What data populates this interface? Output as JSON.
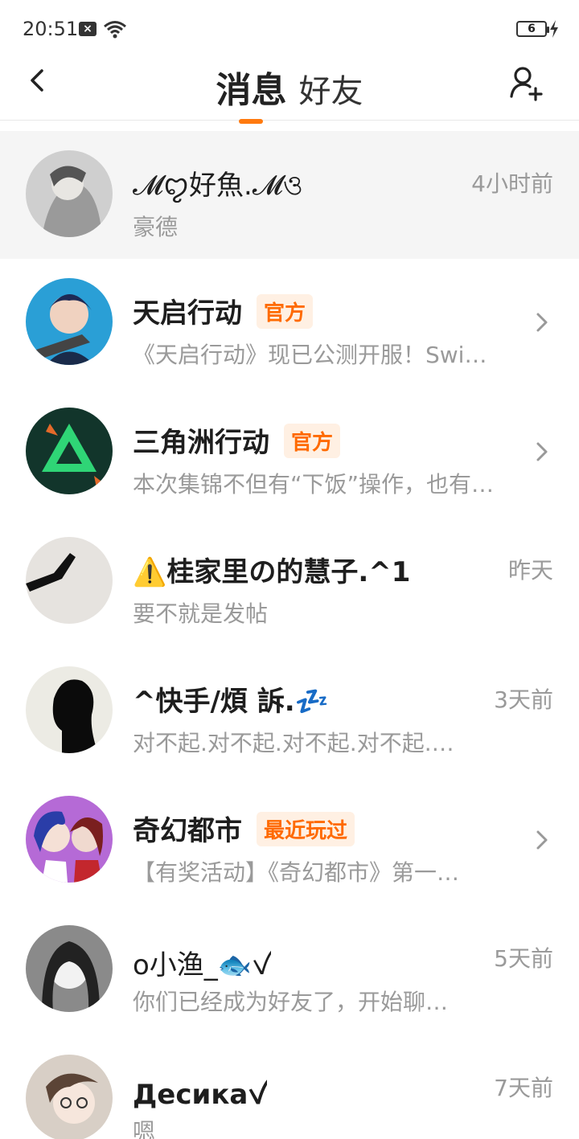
{
  "status": {
    "time": "20:51",
    "x_label": "×",
    "battery": "6"
  },
  "nav": {
    "tab_messages": "消息",
    "tab_friends": "好友"
  },
  "conversations": [
    {
      "name": "𝓜ꨄ︎好魚.𝓜ও",
      "preview": "豪德",
      "time": "4小时前",
      "badge": "",
      "highlight": true
    },
    {
      "name": "天启行动",
      "preview": "《天启行动》现已公测开服！Swi…",
      "time": "",
      "badge": "官方"
    },
    {
      "name": "三角洲行动",
      "preview": "本次集锦不但有“下饭”操作，也有…",
      "time": "",
      "badge": "官方"
    },
    {
      "name": "⚠️桂家里の的慧子.^1",
      "preview": "要不就是发帖",
      "time": "昨天",
      "badge": ""
    },
    {
      "name": "^快手/煩  訴.💤",
      "preview": "对不起.对不起.对不起.对不起.…",
      "time": "3天前",
      "badge": ""
    },
    {
      "name": "奇幻都市",
      "preview": "【有奖活动】《奇幻都市》第一…",
      "time": "",
      "badge": "最近玩过"
    },
    {
      "name": "o小渔_🐟ꪜ",
      "preview": "你们已经成为好友了，开始聊…",
      "time": "5天前",
      "badge": ""
    },
    {
      "name": "Десикаꪜ",
      "preview": "嗯",
      "time": "7天前",
      "badge": ""
    }
  ],
  "colors": {
    "accent": "#ff7a0f",
    "badge_text": "#ff6a00",
    "badge_bg": "#fff0e3",
    "secondary_text": "#9a9a9a"
  }
}
